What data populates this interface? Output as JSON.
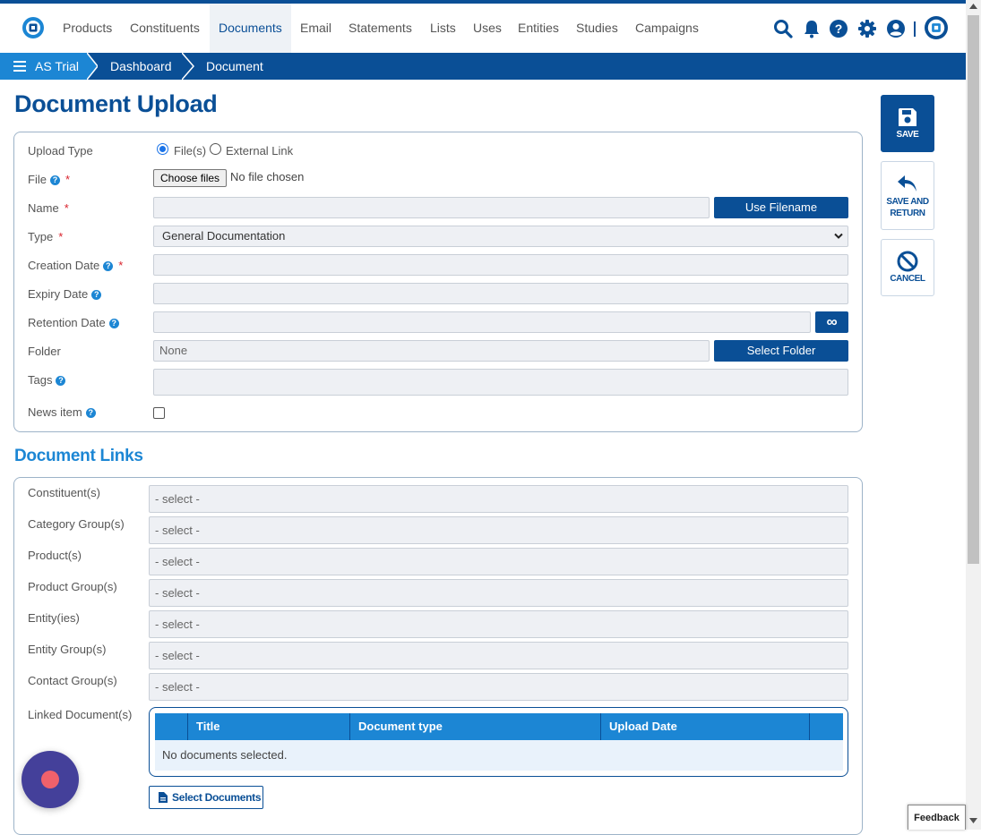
{
  "nav": {
    "items": [
      {
        "label": "Products"
      },
      {
        "label": "Constituents"
      },
      {
        "label": "Documents"
      },
      {
        "label": "Email"
      },
      {
        "label": "Statements"
      },
      {
        "label": "Lists"
      },
      {
        "label": "Uses"
      },
      {
        "label": "Entities"
      },
      {
        "label": "Studies"
      },
      {
        "label": "Campaigns"
      }
    ],
    "active": "Documents",
    "icons": [
      "search-icon",
      "bell-icon",
      "help-icon",
      "gear-icon",
      "user-icon",
      "app-logo-icon"
    ]
  },
  "breadcrumb": {
    "items": [
      {
        "label": "AS Trial"
      },
      {
        "label": "Dashboard"
      },
      {
        "label": "Document"
      }
    ]
  },
  "page": {
    "title": "Document Upload"
  },
  "form": {
    "upload_type": {
      "label": "Upload Type",
      "options": [
        "File(s)",
        "External Link"
      ],
      "selected": "File(s)"
    },
    "file": {
      "label": "File",
      "button": "Choose files",
      "status": "No file chosen"
    },
    "name": {
      "label": "Name",
      "value": "",
      "button": "Use Filename"
    },
    "type": {
      "label": "Type",
      "value": "General Documentation"
    },
    "creation_date": {
      "label": "Creation Date",
      "value": ""
    },
    "expiry_date": {
      "label": "Expiry Date",
      "value": ""
    },
    "retention_date": {
      "label": "Retention Date",
      "value": "",
      "button": "∞"
    },
    "folder": {
      "label": "Folder",
      "value": "None",
      "button": "Select Folder"
    },
    "tags": {
      "label": "Tags",
      "value": ""
    },
    "news_item": {
      "label": "News item",
      "checked": false
    }
  },
  "links": {
    "title": "Document Links",
    "select_placeholder": "- select -",
    "fields": [
      {
        "label": "Constituent(s)"
      },
      {
        "label": "Category Group(s)"
      },
      {
        "label": "Product(s)"
      },
      {
        "label": "Product Group(s)"
      },
      {
        "label": "Entity(ies)"
      },
      {
        "label": "Entity Group(s)"
      },
      {
        "label": "Contact Group(s)"
      }
    ],
    "linked_documents": {
      "label": "Linked Document(s)",
      "columns": [
        "Title",
        "Document type",
        "Upload Date"
      ],
      "empty_text": "No documents selected.",
      "button": "Select Documents"
    }
  },
  "actions": {
    "save": "SAVE",
    "save_return_1": "SAVE AND",
    "save_return_2": "RETURN",
    "cancel": "CANCEL"
  },
  "feedback": "Feedback",
  "colors": {
    "primary": "#0a4f96",
    "accent": "#1c86d4",
    "required": "#d9232d",
    "field_bg": "#eef0f4"
  }
}
